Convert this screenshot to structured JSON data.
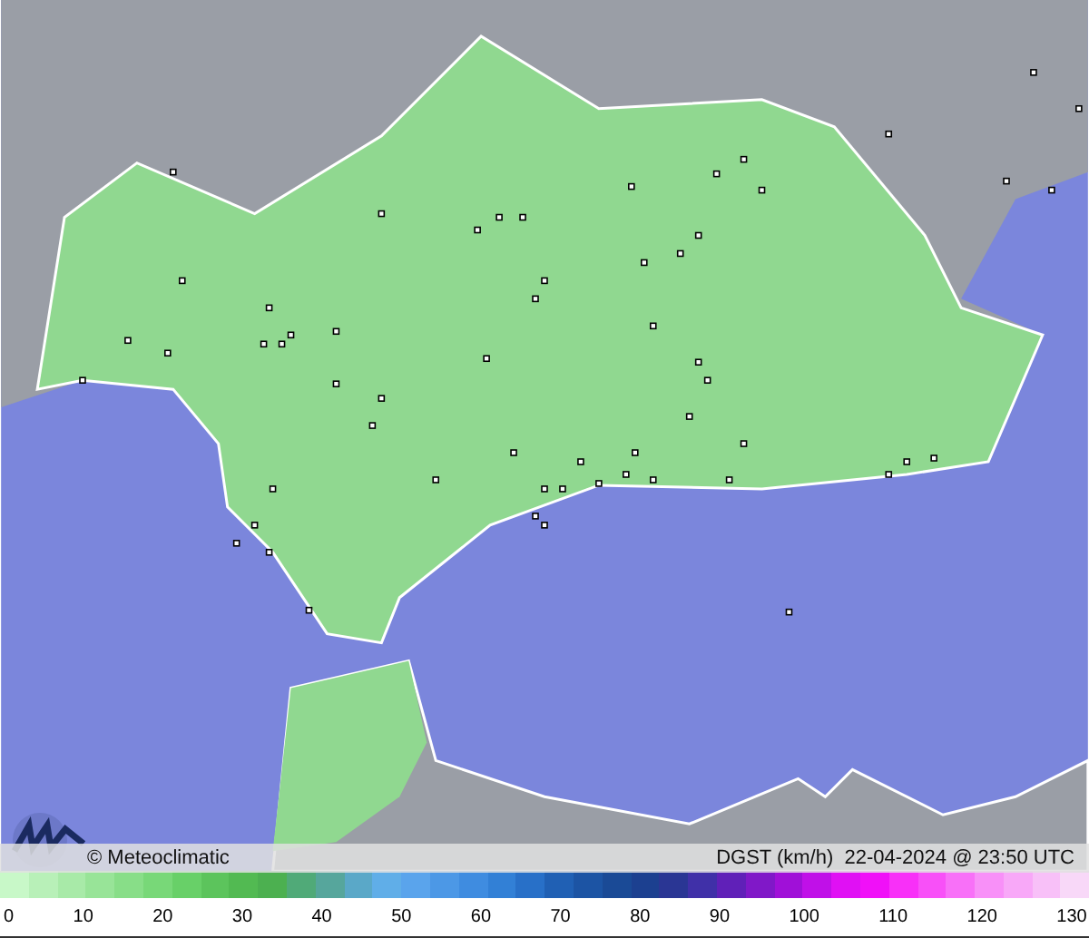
{
  "credit": "© Meteoclimatic",
  "caption": "DGST (km/h)  22-04-2024 @ 23:50 UTC",
  "scale_labels": [
    "0",
    "10",
    "20",
    "30",
    "40",
    "50",
    "60",
    "70",
    "80",
    "90",
    "100",
    "110",
    "120",
    "130"
  ]
}
